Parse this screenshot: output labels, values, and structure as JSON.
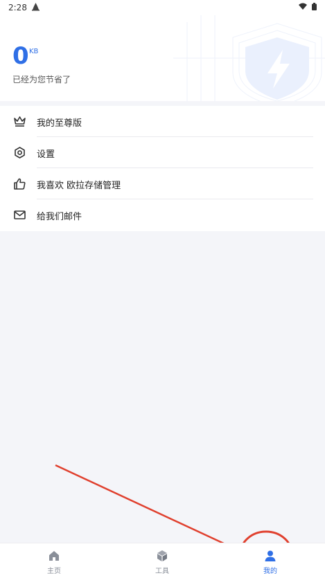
{
  "status_bar": {
    "time": "2:28"
  },
  "summary": {
    "value": "0",
    "unit": "KB",
    "caption": "已经为您节省了"
  },
  "menu": {
    "items": [
      {
        "label": "我的至尊版",
        "icon": "crown-icon"
      },
      {
        "label": "设置",
        "icon": "settings-gear-icon"
      },
      {
        "label": "我喜欢 欧拉存储管理",
        "icon": "thumbs-up-icon"
      },
      {
        "label": "给我们邮件",
        "icon": "mail-icon"
      }
    ]
  },
  "bottom_nav": {
    "items": [
      {
        "label": "主页",
        "icon": "home-icon",
        "active": false
      },
      {
        "label": "工具",
        "icon": "toolbox-cube-icon",
        "active": false
      },
      {
        "label": "我的",
        "icon": "person-icon",
        "active": true
      }
    ]
  },
  "colors": {
    "accent": "#2f6fe6",
    "annotation": "#e0402e",
    "background": "#f4f5f9"
  }
}
